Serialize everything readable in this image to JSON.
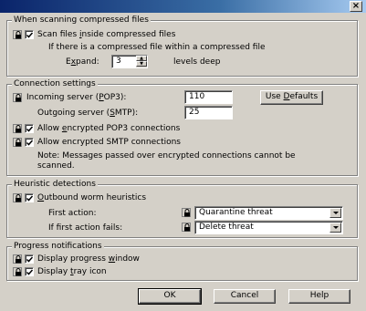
{
  "window": {
    "close_glyph": "×"
  },
  "compressed": {
    "legend": "When scanning compressed files",
    "scan_inside": {
      "pre": "Scan files ",
      "u": "i",
      "post": "nside compressed files",
      "checked": true
    },
    "nested_note": "If there is a compressed file within a compressed file",
    "expand": {
      "pre": "E",
      "u": "x",
      "post": "pand:",
      "value": "3",
      "suffix": "levels deep"
    }
  },
  "connection": {
    "legend": "Connection settings",
    "incoming": {
      "pre": "Incoming server (",
      "u": "P",
      "post": "OP3):",
      "value": "110"
    },
    "outgoing": {
      "pre": "Outgoing server (",
      "u": "S",
      "post": "MTP):",
      "value": "25"
    },
    "use_defaults": {
      "pre": "Use ",
      "u": "D",
      "post": "efaults"
    },
    "encrypted_pop3": {
      "pre": "Allow ",
      "u": "e",
      "post": "ncrypted POP3 connections",
      "checked": true
    },
    "encrypted_smtp": {
      "pre": "Allow encrypted SMTP connections",
      "checked": true
    },
    "note_line1": "Note: Messages passed over encrypted connections cannot be",
    "note_line2": "scanned."
  },
  "heuristic": {
    "legend": "Heuristic detections",
    "outbound": {
      "pre": "",
      "u": "O",
      "post": "utbound worm heuristics",
      "checked": true
    },
    "first_action_label": "First action:",
    "first_action_value": "Quarantine threat",
    "fail_action_label": "If first action fails:",
    "fail_action_value": "Delete threat"
  },
  "progress": {
    "legend": "Progress notifications",
    "progress_window": {
      "pre": "Display progress ",
      "u": "w",
      "post": "indow",
      "checked": true
    },
    "tray_icon": {
      "pre": "Display ",
      "u": "t",
      "post": "ray icon",
      "checked": true
    }
  },
  "buttons": {
    "ok": "OK",
    "cancel": "Cancel",
    "help": "Help"
  },
  "icons": {
    "lock": "lock-icon",
    "check": "checkmark-icon",
    "dropdown": "chevron-down-icon"
  }
}
